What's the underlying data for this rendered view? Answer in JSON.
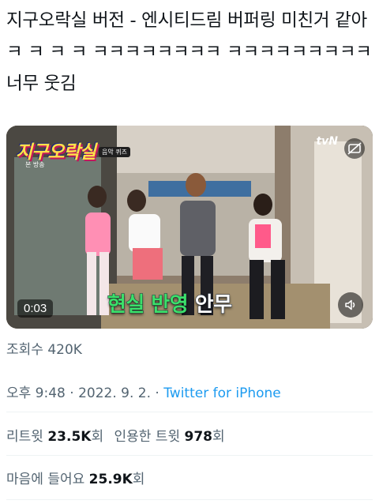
{
  "tweet": {
    "text": "지구오락실 버전 - 엔시티드림 버퍼링 미친거 같아ㅋ ㅋ ㅋ ㅋ ㅋㅋㅋㅋㅋㅋㅋㅋ ㅋㅋㅋㅋㅋㅋㅋㅋㅋ 너무 웃김"
  },
  "video": {
    "duration": "0:03",
    "show_logo": "지구오락실",
    "show_sub": "음악 퀴즈",
    "show_sub2": "본 방송",
    "channel": "tvN",
    "caption_green": "현실 반영",
    "caption_white": "안무",
    "icons": [
      "speaker-icon",
      "caption-icon"
    ]
  },
  "meta": {
    "views_label": "조회수",
    "views_value": "420K",
    "time": "오후 9:48",
    "dot1": " · ",
    "date": "2022. 9. 2.",
    "dot2": " · ",
    "source": "Twitter for iPhone"
  },
  "stats": {
    "retweets_label": "리트윗",
    "retweets_value": "23.5K",
    "retweets_unit": "회",
    "quotes_label": "인용한 트윗",
    "quotes_value": "978",
    "quotes_unit": "회",
    "likes_label": "마음에 들어요",
    "likes_value": "25.9K",
    "likes_unit": "회"
  },
  "colors": {
    "link": "#1d9bf0",
    "secondary": "#536471",
    "caption_green": "#3ce06a"
  }
}
